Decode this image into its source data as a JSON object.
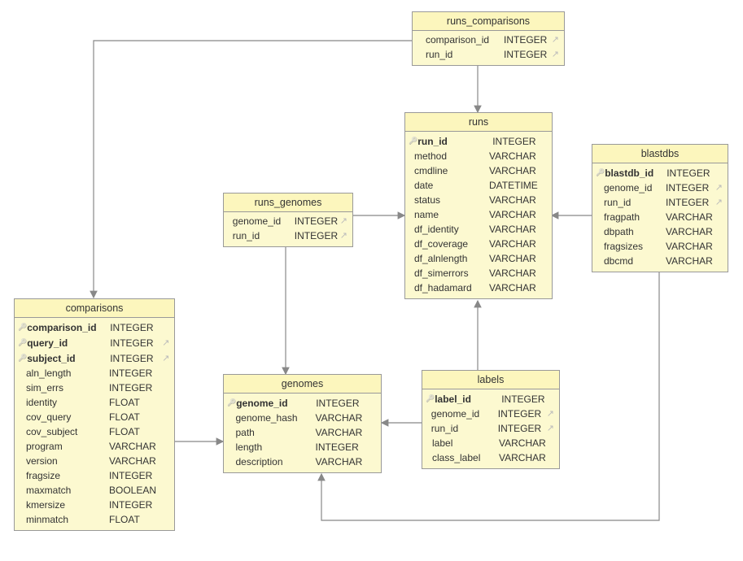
{
  "tables": {
    "runs_comparisons": {
      "title": "runs_comparisons",
      "cols": [
        {
          "name": "comparison_id",
          "type": "INTEGER",
          "pk": false,
          "fk": true
        },
        {
          "name": "run_id",
          "type": "INTEGER",
          "pk": false,
          "fk": true
        }
      ]
    },
    "runs": {
      "title": "runs",
      "cols": [
        {
          "name": "run_id",
          "type": "INTEGER",
          "pk": true,
          "fk": false
        },
        {
          "name": "method",
          "type": "VARCHAR",
          "pk": false,
          "fk": false
        },
        {
          "name": "cmdline",
          "type": "VARCHAR",
          "pk": false,
          "fk": false
        },
        {
          "name": "date",
          "type": "DATETIME",
          "pk": false,
          "fk": false
        },
        {
          "name": "status",
          "type": "VARCHAR",
          "pk": false,
          "fk": false
        },
        {
          "name": "name",
          "type": "VARCHAR",
          "pk": false,
          "fk": false
        },
        {
          "name": "df_identity",
          "type": "VARCHAR",
          "pk": false,
          "fk": false
        },
        {
          "name": "df_coverage",
          "type": "VARCHAR",
          "pk": false,
          "fk": false
        },
        {
          "name": "df_alnlength",
          "type": "VARCHAR",
          "pk": false,
          "fk": false
        },
        {
          "name": "df_simerrors",
          "type": "VARCHAR",
          "pk": false,
          "fk": false
        },
        {
          "name": "df_hadamard",
          "type": "VARCHAR",
          "pk": false,
          "fk": false
        }
      ]
    },
    "blastdbs": {
      "title": "blastdbs",
      "cols": [
        {
          "name": "blastdb_id",
          "type": "INTEGER",
          "pk": true,
          "fk": false
        },
        {
          "name": "genome_id",
          "type": "INTEGER",
          "pk": false,
          "fk": true
        },
        {
          "name": "run_id",
          "type": "INTEGER",
          "pk": false,
          "fk": true
        },
        {
          "name": "fragpath",
          "type": "VARCHAR",
          "pk": false,
          "fk": false
        },
        {
          "name": "dbpath",
          "type": "VARCHAR",
          "pk": false,
          "fk": false
        },
        {
          "name": "fragsizes",
          "type": "VARCHAR",
          "pk": false,
          "fk": false
        },
        {
          "name": "dbcmd",
          "type": "VARCHAR",
          "pk": false,
          "fk": false
        }
      ]
    },
    "runs_genomes": {
      "title": "runs_genomes",
      "cols": [
        {
          "name": "genome_id",
          "type": "INTEGER",
          "pk": false,
          "fk": true
        },
        {
          "name": "run_id",
          "type": "INTEGER",
          "pk": false,
          "fk": true
        }
      ]
    },
    "comparisons": {
      "title": "comparisons",
      "cols": [
        {
          "name": "comparison_id",
          "type": "INTEGER",
          "pk": true,
          "fk": false
        },
        {
          "name": "query_id",
          "type": "INTEGER",
          "pk": true,
          "fk": true
        },
        {
          "name": "subject_id",
          "type": "INTEGER",
          "pk": true,
          "fk": true
        },
        {
          "name": "aln_length",
          "type": "INTEGER",
          "pk": false,
          "fk": false
        },
        {
          "name": "sim_errs",
          "type": "INTEGER",
          "pk": false,
          "fk": false
        },
        {
          "name": "identity",
          "type": "FLOAT",
          "pk": false,
          "fk": false
        },
        {
          "name": "cov_query",
          "type": "FLOAT",
          "pk": false,
          "fk": false
        },
        {
          "name": "cov_subject",
          "type": "FLOAT",
          "pk": false,
          "fk": false
        },
        {
          "name": "program",
          "type": "VARCHAR",
          "pk": false,
          "fk": false
        },
        {
          "name": "version",
          "type": "VARCHAR",
          "pk": false,
          "fk": false
        },
        {
          "name": "fragsize",
          "type": "INTEGER",
          "pk": false,
          "fk": false
        },
        {
          "name": "maxmatch",
          "type": "BOOLEAN",
          "pk": false,
          "fk": false
        },
        {
          "name": "kmersize",
          "type": "INTEGER",
          "pk": false,
          "fk": false
        },
        {
          "name": "minmatch",
          "type": "FLOAT",
          "pk": false,
          "fk": false
        }
      ]
    },
    "genomes": {
      "title": "genomes",
      "cols": [
        {
          "name": "genome_id",
          "type": "INTEGER",
          "pk": true,
          "fk": false
        },
        {
          "name": "genome_hash",
          "type": "VARCHAR",
          "pk": false,
          "fk": false
        },
        {
          "name": "path",
          "type": "VARCHAR",
          "pk": false,
          "fk": false
        },
        {
          "name": "length",
          "type": "INTEGER",
          "pk": false,
          "fk": false
        },
        {
          "name": "description",
          "type": "VARCHAR",
          "pk": false,
          "fk": false
        }
      ]
    },
    "labels": {
      "title": "labels",
      "cols": [
        {
          "name": "label_id",
          "type": "INTEGER",
          "pk": true,
          "fk": false
        },
        {
          "name": "genome_id",
          "type": "INTEGER",
          "pk": false,
          "fk": true
        },
        {
          "name": "run_id",
          "type": "INTEGER",
          "pk": false,
          "fk": true
        },
        {
          "name": "label",
          "type": "VARCHAR",
          "pk": false,
          "fk": false
        },
        {
          "name": "class_label",
          "type": "VARCHAR",
          "pk": false,
          "fk": false
        }
      ]
    }
  },
  "relationships": [
    {
      "from": "runs_comparisons",
      "to": "comparisons"
    },
    {
      "from": "runs_comparisons",
      "to": "runs"
    },
    {
      "from": "runs_genomes",
      "to": "runs"
    },
    {
      "from": "runs_genomes",
      "to": "genomes"
    },
    {
      "from": "blastdbs",
      "to": "runs"
    },
    {
      "from": "blastdbs",
      "to": "genomes"
    },
    {
      "from": "labels",
      "to": "runs"
    },
    {
      "from": "labels",
      "to": "genomes"
    },
    {
      "from": "comparisons",
      "to": "genomes"
    }
  ]
}
